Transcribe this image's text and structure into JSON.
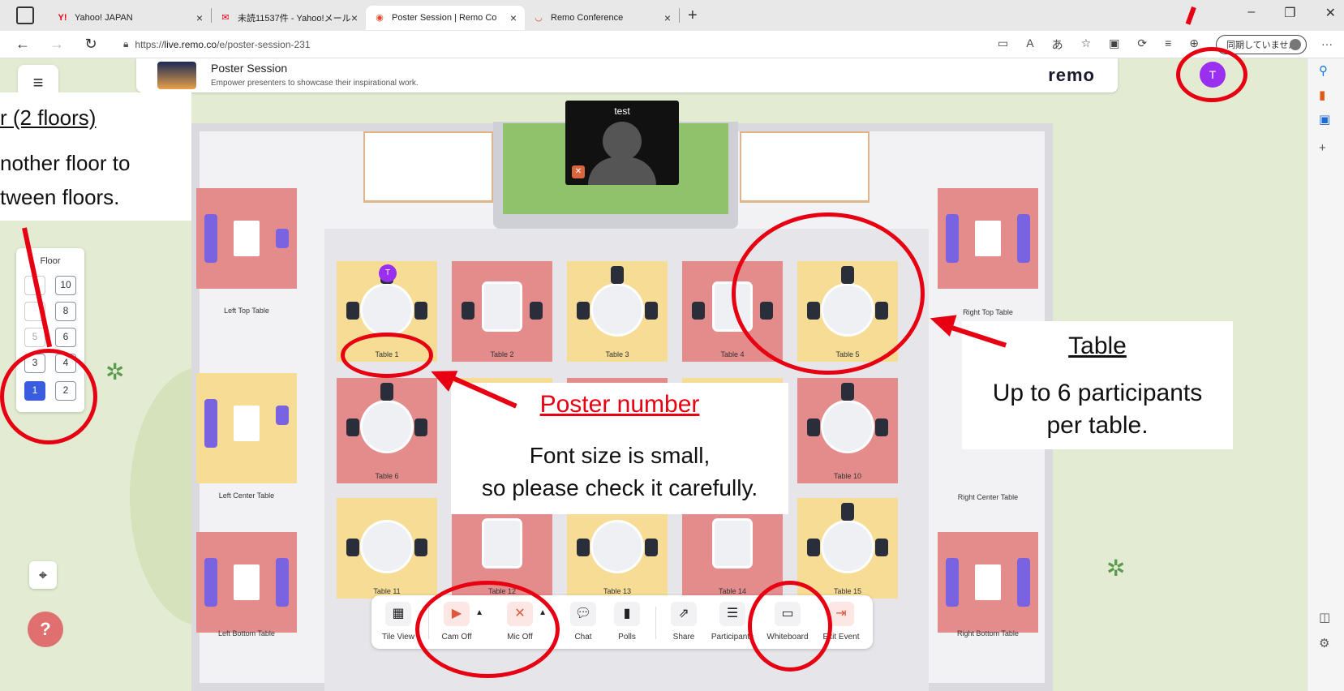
{
  "browser": {
    "tabs": [
      {
        "title": "Yahoo! JAPAN",
        "icon": "yahoo-favicon"
      },
      {
        "title": "未読11537件 - Yahoo!メール",
        "icon": "yahoo-mail-favicon"
      },
      {
        "title": "Poster Session  | Remo Co",
        "icon": "remo-favicon",
        "active": true
      },
      {
        "title": "Remo Conference",
        "icon": "remo-favicon"
      }
    ],
    "url_prefix": "https://",
    "url_host": "live.remo.co",
    "url_path": "/e/poster-session-231",
    "sync_label": "同期していません"
  },
  "header": {
    "title": "Poster Session",
    "subtitle": "Empower presenters to showcase their inspirational work.",
    "logo": "remo",
    "avatar_initial": "T"
  },
  "stage": {
    "video_name": "test"
  },
  "floor_selector": {
    "title": "Floor",
    "floors": [
      "10",
      "8",
      "5",
      "6",
      "3",
      "4",
      "1",
      "2"
    ],
    "selected": "1"
  },
  "tables": [
    "Table 1",
    "Table 2",
    "Table 3",
    "Table 4",
    "Table 5",
    "Table 6",
    "Table 10",
    "Table 11",
    "Table 12",
    "Table 13",
    "Table 14",
    "Table 15"
  ],
  "side_tables": {
    "left_top": "Left Top Table",
    "left_center": "Left Center Table",
    "left_bottom": "Left Bottom Table",
    "right_top": "Right Top Table",
    "right_center": "Right Center Table",
    "right_bottom": "Right Bottom Table"
  },
  "toolbar": {
    "tile_view": "Tile View",
    "cam": "Cam Off",
    "mic": "Mic Off",
    "chat": "Chat",
    "polls": "Polls",
    "share": "Share",
    "participants": "Participants",
    "whiteboard": "Whiteboard",
    "exit": "Exit Event"
  },
  "annotations": {
    "floor_title": "r (2 floors)",
    "floor_body_1": "nother floor to",
    "floor_body_2": "tween floors.",
    "poster_title": "Poster number",
    "poster_body_1": "Font size is small,",
    "poster_body_2": "so please check it carefully.",
    "table_title": "Table",
    "table_body_1": "Up to 6 participants",
    "table_body_2": "per table.",
    "accent_color": "#e60012"
  }
}
